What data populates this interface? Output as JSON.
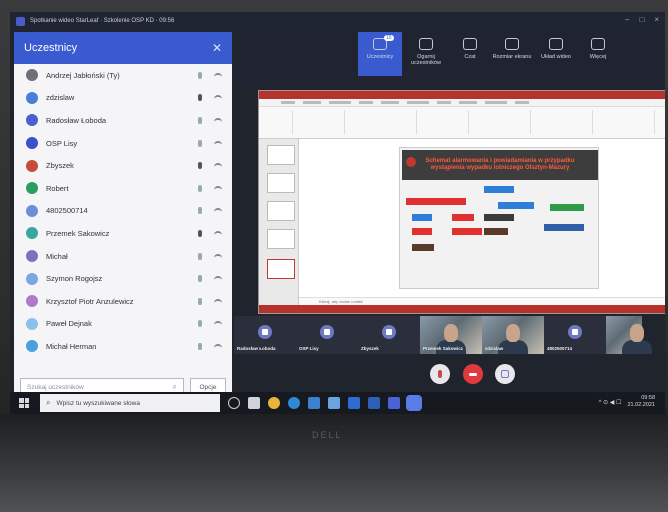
{
  "window": {
    "title": "Spotkanie wideo StarLeaf · Szkolenie OSP KD · 09:56"
  },
  "participants_panel": {
    "title": "Uczestnicy",
    "close_icon": "close-icon",
    "search_placeholder": "Szukaj uczestników",
    "options_label": "Opcje",
    "participants": [
      {
        "name": "Andrzej Jabłoński (Ty)",
        "avatar_color": "#6b6f7a",
        "mic_dark": false
      },
      {
        "name": "zdzislaw",
        "avatar_color": "#4a7fd8",
        "mic_dark": true
      },
      {
        "name": "Radosław Łoboda",
        "avatar_color": "#4a5fd0",
        "mic_dark": false
      },
      {
        "name": "OSP Lisy",
        "avatar_color": "#3c50c8",
        "mic_dark": false
      },
      {
        "name": "Zbyszek",
        "avatar_color": "#c84a3c",
        "mic_dark": true
      },
      {
        "name": "Robert",
        "avatar_color": "#2e9c5a",
        "mic_dark": false
      },
      {
        "name": "4802500714",
        "avatar_color": "#6a8fd8",
        "mic_dark": false
      },
      {
        "name": "Przemek Sakowicz",
        "avatar_color": "#3aa6a0",
        "mic_dark": true
      },
      {
        "name": "Michał",
        "avatar_color": "#7a72c0",
        "mic_dark": false
      },
      {
        "name": "Szymon Rogojsz",
        "avatar_color": "#7aa6e6",
        "mic_dark": false
      },
      {
        "name": "Krzysztof Piotr Anzulewicz",
        "avatar_color": "#b07ac8",
        "mic_dark": false
      },
      {
        "name": "Paweł Dejnak",
        "avatar_color": "#8cc0e8",
        "mic_dark": false
      },
      {
        "name": "Michał Herman",
        "avatar_color": "#4aa0d8",
        "mic_dark": false
      }
    ]
  },
  "meeting_toolbar": {
    "items": [
      {
        "label": "Uczestnicy",
        "badge": "15",
        "active": true
      },
      {
        "label": "Ogarnij uczestników",
        "active": false
      },
      {
        "label": "Czat",
        "active": false
      },
      {
        "label": "Rozmiar ekranu",
        "active": false
      },
      {
        "label": "Układ wideo",
        "active": false
      },
      {
        "label": "Więcej",
        "active": false
      }
    ]
  },
  "slide": {
    "title": "Schemat alarmowania i powiadamiania w przypadku wystąpienia wypadku lotniczego Olsztyn-Mazury",
    "notes_placeholder": "Kliknij, aby dodać notatki"
  },
  "video_tiles": [
    {
      "label": "Radosław Łoboda",
      "type": "cam-off"
    },
    {
      "label": "OSP Lisy",
      "type": "cam-off"
    },
    {
      "label": "Zbyszek",
      "type": "cam-off"
    },
    {
      "label": "Przemek Sakowicz",
      "type": "video"
    },
    {
      "label": "zdzislaw",
      "type": "video"
    },
    {
      "label": "4802500714",
      "type": "cam-off"
    },
    {
      "label": "",
      "type": "video"
    }
  ],
  "taskbar": {
    "search_placeholder": "Wpisz tu wyszukiwane słowa",
    "time": "09:58",
    "date": "21.02.2021"
  }
}
